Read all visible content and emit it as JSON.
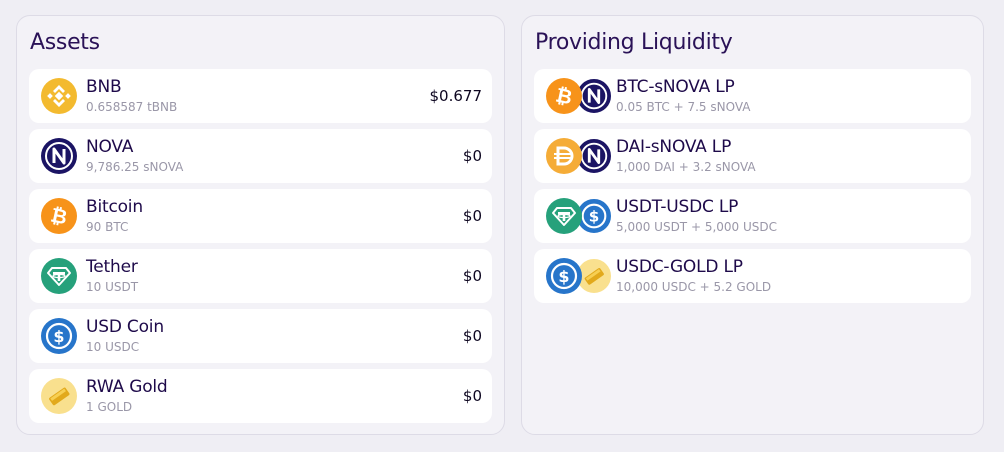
{
  "assets": {
    "title": "Assets",
    "items": [
      {
        "name": "BNB",
        "amount": "0.658587 tBNB",
        "value": "$0.677",
        "icon": "bnb-icon"
      },
      {
        "name": "NOVA",
        "amount": "9,786.25 sNOVA",
        "value": "$0",
        "icon": "nova-icon"
      },
      {
        "name": "Bitcoin",
        "amount": "90 BTC",
        "value": "$0",
        "icon": "bitcoin-icon"
      },
      {
        "name": "Tether",
        "amount": "10 USDT",
        "value": "$0",
        "icon": "tether-icon"
      },
      {
        "name": "USD Coin",
        "amount": "10 USDC",
        "value": "$0",
        "icon": "usdc-icon"
      },
      {
        "name": "RWA Gold",
        "amount": "1 GOLD",
        "value": "$0",
        "icon": "gold-icon"
      }
    ]
  },
  "liquidity": {
    "title": "Providing Liquidity",
    "items": [
      {
        "name": "BTC-sNOVA LP",
        "amount": "0.05 BTC + 7.5 sNOVA",
        "icons": [
          "bitcoin-icon",
          "nova-icon"
        ]
      },
      {
        "name": "DAI-sNOVA LP",
        "amount": "1,000 DAI + 3.2 sNOVA",
        "icons": [
          "dai-icon",
          "nova-icon"
        ]
      },
      {
        "name": "USDT-USDC LP",
        "amount": "5,000 USDT + 5,000 USDC",
        "icons": [
          "tether-icon",
          "usdc-icon"
        ]
      },
      {
        "name": "USDC-GOLD LP",
        "amount": "10,000 USDC + 5.2 GOLD",
        "icons": [
          "usdc-icon",
          "gold-icon"
        ]
      }
    ]
  },
  "colors": {
    "bnb": "#f3ba2f",
    "nova": "#1b1464",
    "bitcoin": "#f7931a",
    "tether": "#26a17b",
    "usdc": "#2775ca",
    "dai": "#f5ac37",
    "gold": "#f6d66a"
  }
}
